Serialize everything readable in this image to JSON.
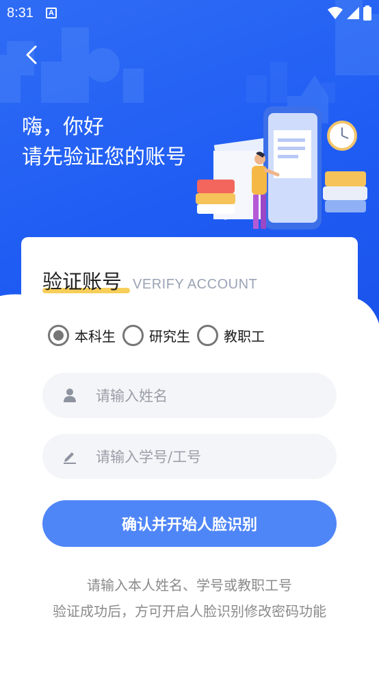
{
  "status_bar": {
    "time": "8:31",
    "badge": "A"
  },
  "greeting": {
    "line1": "嗨，你好",
    "line2": "请先验证您的账号"
  },
  "card": {
    "title": "验证账号",
    "subtitle": "VERIFY ACCOUNT"
  },
  "role_options": [
    {
      "label": "本科生",
      "selected": true
    },
    {
      "label": "研究生",
      "selected": false
    },
    {
      "label": "教职工",
      "selected": false
    }
  ],
  "inputs": {
    "name": {
      "placeholder": "请输入姓名",
      "value": ""
    },
    "id": {
      "placeholder": "请输入学号/工号",
      "value": ""
    }
  },
  "submit": {
    "label": "确认并开始人脸识别"
  },
  "hints": {
    "line1": "请输入本人姓名、学号或教职工号",
    "line2": "验证成功后，方可开启人脸识别修改密码功能"
  },
  "colors": {
    "hero": "#1f5cf3",
    "button": "#4f86f7",
    "underline": "#f7c948"
  }
}
